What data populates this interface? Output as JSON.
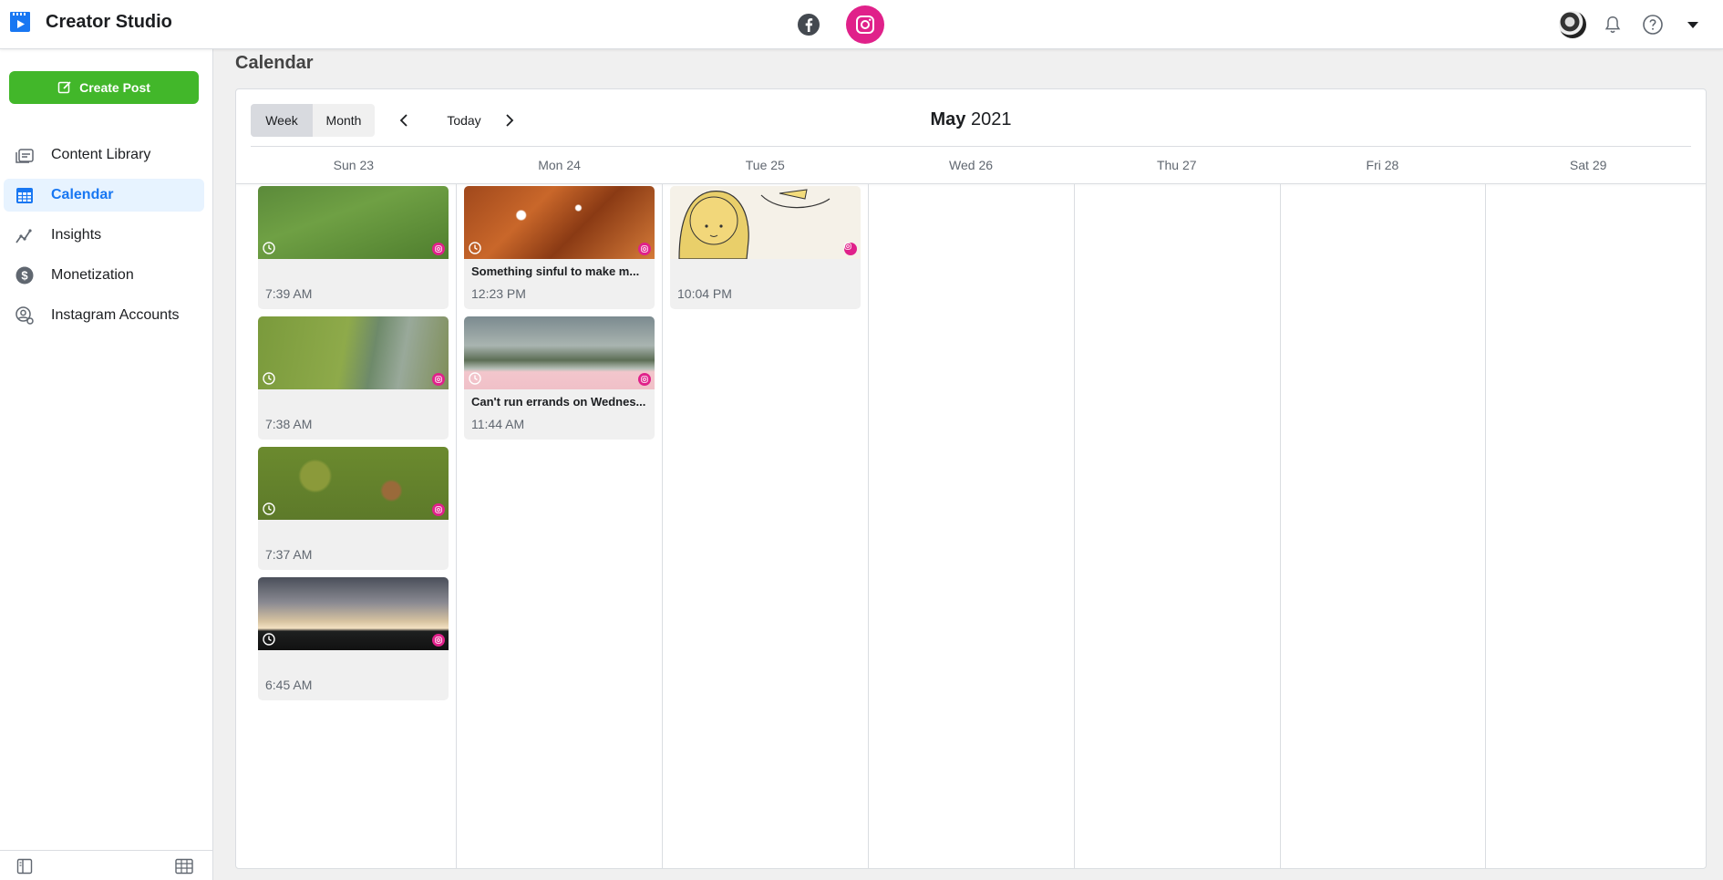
{
  "app": {
    "title": "Creator Studio"
  },
  "topbar": {
    "platforms": [
      "facebook-icon",
      "instagram-icon"
    ],
    "active_platform": "instagram",
    "colors": {
      "instagram": "#e0218a",
      "facebook": "#444950"
    }
  },
  "sidebar": {
    "create_post": "Create Post",
    "items": [
      {
        "label": "Content Library",
        "icon": "content-library-icon",
        "active": false
      },
      {
        "label": "Calendar",
        "icon": "calendar-icon",
        "active": true
      },
      {
        "label": "Insights",
        "icon": "insights-icon",
        "active": false
      },
      {
        "label": "Monetization",
        "icon": "monetization-icon",
        "active": false
      },
      {
        "label": "Instagram Accounts",
        "icon": "instagram-accounts-icon",
        "active": false
      }
    ],
    "colors": {
      "create_post": "#42b72a",
      "active": "#1877f2"
    }
  },
  "page": {
    "title": "Calendar"
  },
  "calendar": {
    "views": {
      "week": "Week",
      "month": "Month"
    },
    "selected_view": "week",
    "today": "Today",
    "month": "May",
    "year": "2021",
    "days": [
      "Sun 23",
      "Mon 24",
      "Tue 25",
      "Wed 26",
      "Thu 27",
      "Fri 28",
      "Sat 29"
    ],
    "posts": {
      "sun": [
        {
          "caption": "",
          "time": "7:39 AM"
        },
        {
          "caption": "",
          "time": "7:38 AM"
        },
        {
          "caption": "",
          "time": "7:37 AM"
        },
        {
          "caption": "",
          "time": "6:45 AM"
        }
      ],
      "mon": [
        {
          "caption": "Something sinful to make m...",
          "time": "12:23 PM"
        },
        {
          "caption": "Can't run errands on Wednes...",
          "time": "11:44 AM"
        }
      ],
      "tue": [
        {
          "caption": "",
          "time": "10:04 PM"
        }
      ]
    }
  }
}
